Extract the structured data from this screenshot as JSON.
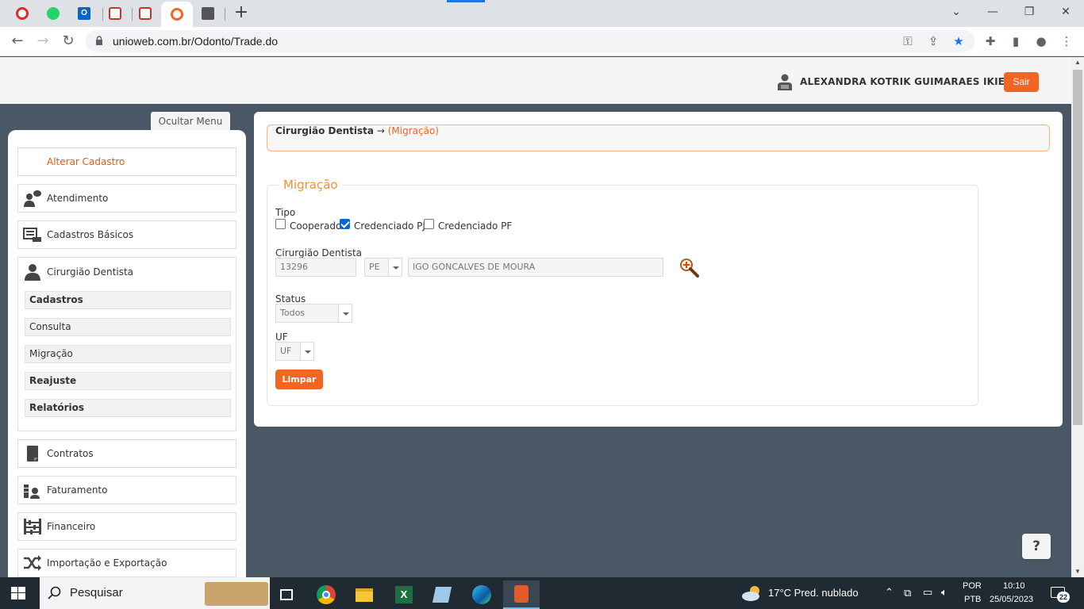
{
  "browser": {
    "url": "unioweb.com.br/Odonto/Trade.do",
    "tabs": [
      "tab-1",
      "whatsapp",
      "outlook",
      "tab-4",
      "tab-5",
      "unioweb",
      "tab-7"
    ]
  },
  "header": {
    "user_name": "ALEXANDRA KOTRIK GUIMARAES IKIER",
    "logout_label": "Sair"
  },
  "sidebar": {
    "toggle_label": "Ocultar Menu",
    "alter_label": "Alterar Cadastro",
    "items": [
      {
        "label": "Atendimento",
        "icon": "person-speech-icon"
      },
      {
        "label": "Cadastros Básicos",
        "icon": "keyboard-icon"
      },
      {
        "label": "Cirurgião Dentista",
        "icon": "person-icon"
      },
      {
        "label": "Contratos",
        "icon": "document-icon"
      },
      {
        "label": "Faturamento",
        "icon": "billing-icon"
      },
      {
        "label": "Financeiro",
        "icon": "abacus-icon"
      },
      {
        "label": "Importação e Exportação",
        "icon": "shuffle-icon"
      }
    ],
    "sub_items": [
      "Cadastros",
      "Consulta",
      "Migração",
      "Reajuste",
      "Relatórios"
    ]
  },
  "breadcrumb": {
    "parent": "Cirurgião Dentista",
    "arrow": "→",
    "current": "(Migração)"
  },
  "form": {
    "legend": "Migração",
    "tipo_label": "Tipo",
    "checkboxes": [
      {
        "label": "Cooperado",
        "checked": false
      },
      {
        "label": "Credenciado PJ",
        "checked": true
      },
      {
        "label": "Credenciado PF",
        "checked": false
      }
    ],
    "dentista_label": "Cirurgião Dentista",
    "dentista_code": "13296",
    "dentista_uf": "PE",
    "dentista_name": "IGO GONCALVES DE MOURA",
    "status_label": "Status",
    "status_value": "Todos",
    "uf_label": "UF",
    "uf_value": "UF",
    "clear_label": "Limpar"
  },
  "help_label": "?",
  "taskbar": {
    "search_placeholder": "Pesquisar",
    "weather": "17°C  Pred. nublado",
    "lang_top": "POR",
    "lang_bottom": "PTB",
    "time": "10:10",
    "date": "25/05/2023",
    "notifications": "22"
  }
}
